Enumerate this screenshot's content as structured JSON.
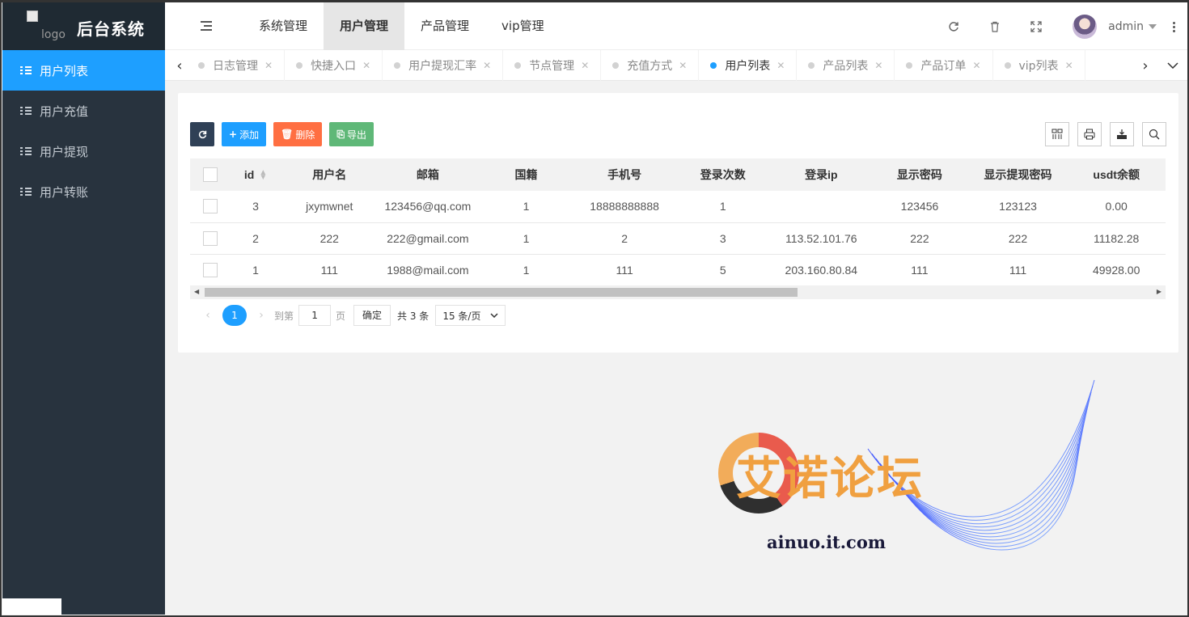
{
  "app": {
    "logo_alt": "logo",
    "title": "后台系统"
  },
  "sidebar": {
    "items": [
      {
        "label": "用户列表",
        "active": true
      },
      {
        "label": "用户充值",
        "active": false
      },
      {
        "label": "用户提现",
        "active": false
      },
      {
        "label": "用户转账",
        "active": false
      }
    ]
  },
  "topnav": {
    "items": [
      {
        "label": "系统管理",
        "active": false
      },
      {
        "label": "用户管理",
        "active": true
      },
      {
        "label": "产品管理",
        "active": false
      },
      {
        "label": "vip管理",
        "active": false
      }
    ]
  },
  "header": {
    "username": "admin",
    "icons": [
      "refresh-icon",
      "trash-icon",
      "fullscreen-icon"
    ]
  },
  "tabs": [
    {
      "label": "日志管理",
      "active": false
    },
    {
      "label": "快捷入口",
      "active": false
    },
    {
      "label": "用户提现汇率",
      "active": false
    },
    {
      "label": "节点管理",
      "active": false
    },
    {
      "label": "充值方式",
      "active": false
    },
    {
      "label": "用户列表",
      "active": true
    },
    {
      "label": "产品列表",
      "active": false
    },
    {
      "label": "产品订单",
      "active": false
    },
    {
      "label": "vip列表",
      "active": false
    }
  ],
  "toolbar": {
    "add_label": "添加",
    "delete_label": "删除",
    "export_label": "导出"
  },
  "table": {
    "columns": [
      "id",
      "用户名",
      "邮箱",
      "国籍",
      "手机号",
      "登录次数",
      "登录ip",
      "显示密码",
      "显示提现密码",
      "usdt余额"
    ],
    "rows": [
      [
        "3",
        "jxymwnet",
        "123456@qq.com",
        "1",
        "18888888888",
        "1",
        "",
        "123456",
        "123123",
        "0.00"
      ],
      [
        "2",
        "222",
        "222@gmail.com",
        "1",
        "2",
        "3",
        "113.52.101.76",
        "222",
        "222",
        "11182.28"
      ],
      [
        "1",
        "111",
        "1988@mail.com",
        "1",
        "111",
        "5",
        "203.160.80.84",
        "111",
        "111",
        "49928.00"
      ]
    ]
  },
  "pager": {
    "current": "1",
    "goto_label": "到第",
    "goto_value": "1",
    "page_unit": "页",
    "confirm_label": "确定",
    "total_label": "共 3 条",
    "page_size": "15 条/页"
  },
  "watermark": {
    "text": "艾诺论坛",
    "url": "ainuo.it.com"
  }
}
